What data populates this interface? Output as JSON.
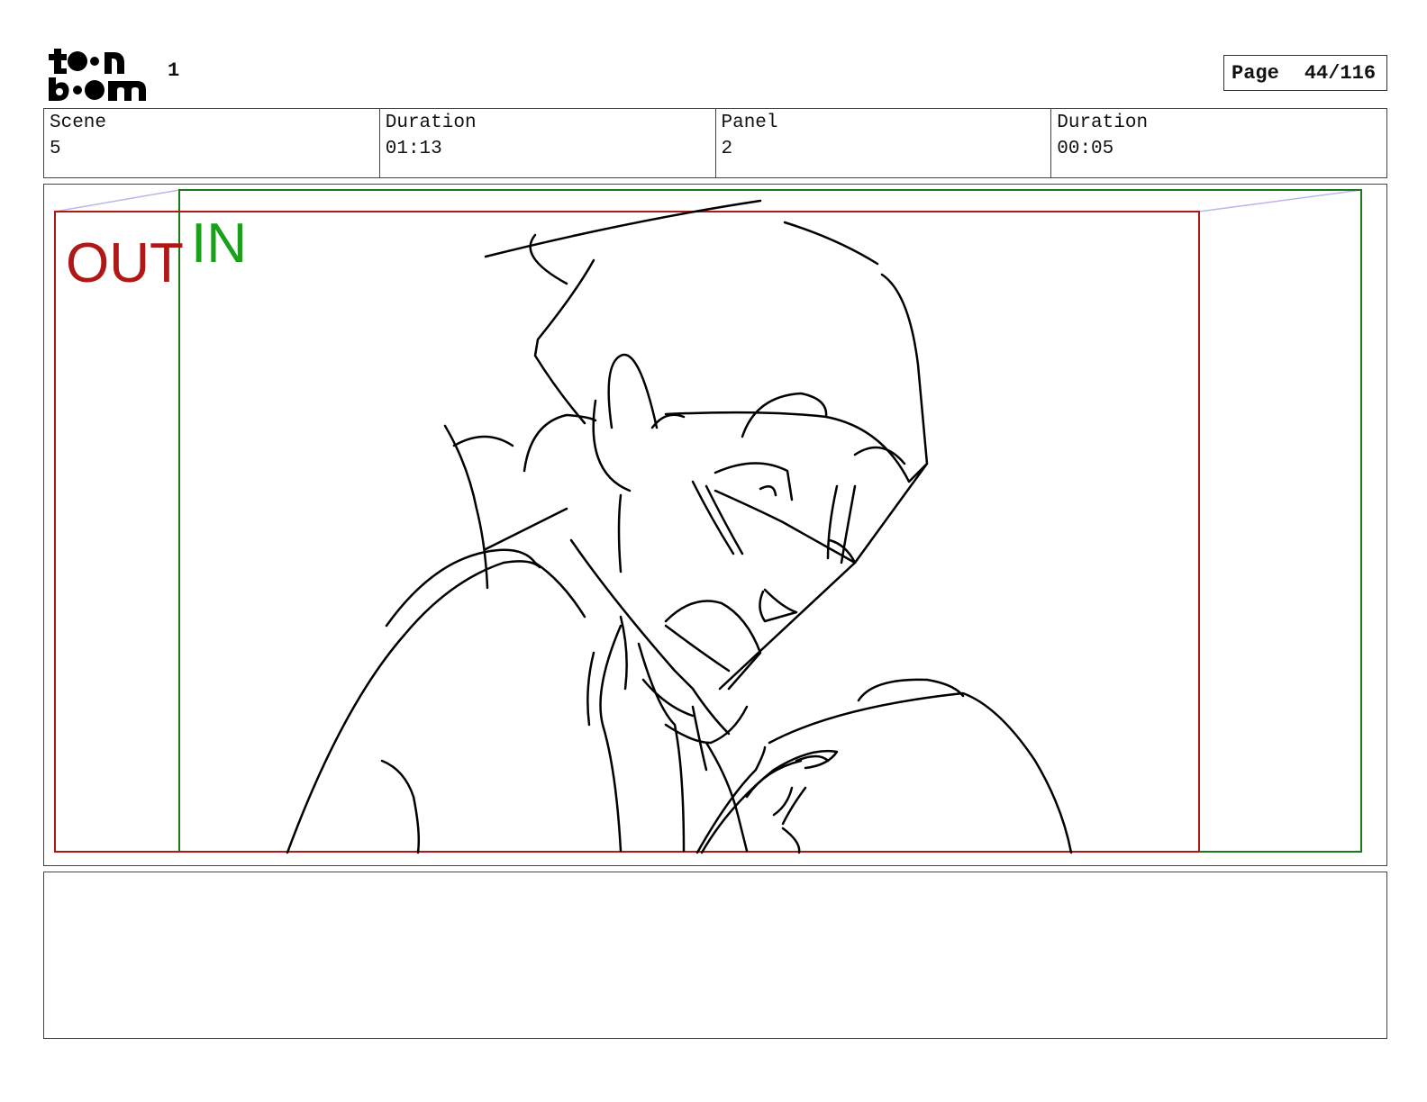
{
  "header": {
    "project_number": "1",
    "page_label": "Page",
    "page_value": "44/116"
  },
  "info": {
    "scene_label": "Scene",
    "scene_value": "5",
    "scene_duration_label": "Duration",
    "scene_duration_value": "01:13",
    "panel_label": "Panel",
    "panel_value": "2",
    "panel_duration_label": "Duration",
    "panel_duration_value": "00:05"
  },
  "camera": {
    "out_label": "OUT",
    "in_label": "IN",
    "out_color": "#b01818",
    "in_color": "#1aa01a"
  },
  "caption": {
    "text": ""
  }
}
